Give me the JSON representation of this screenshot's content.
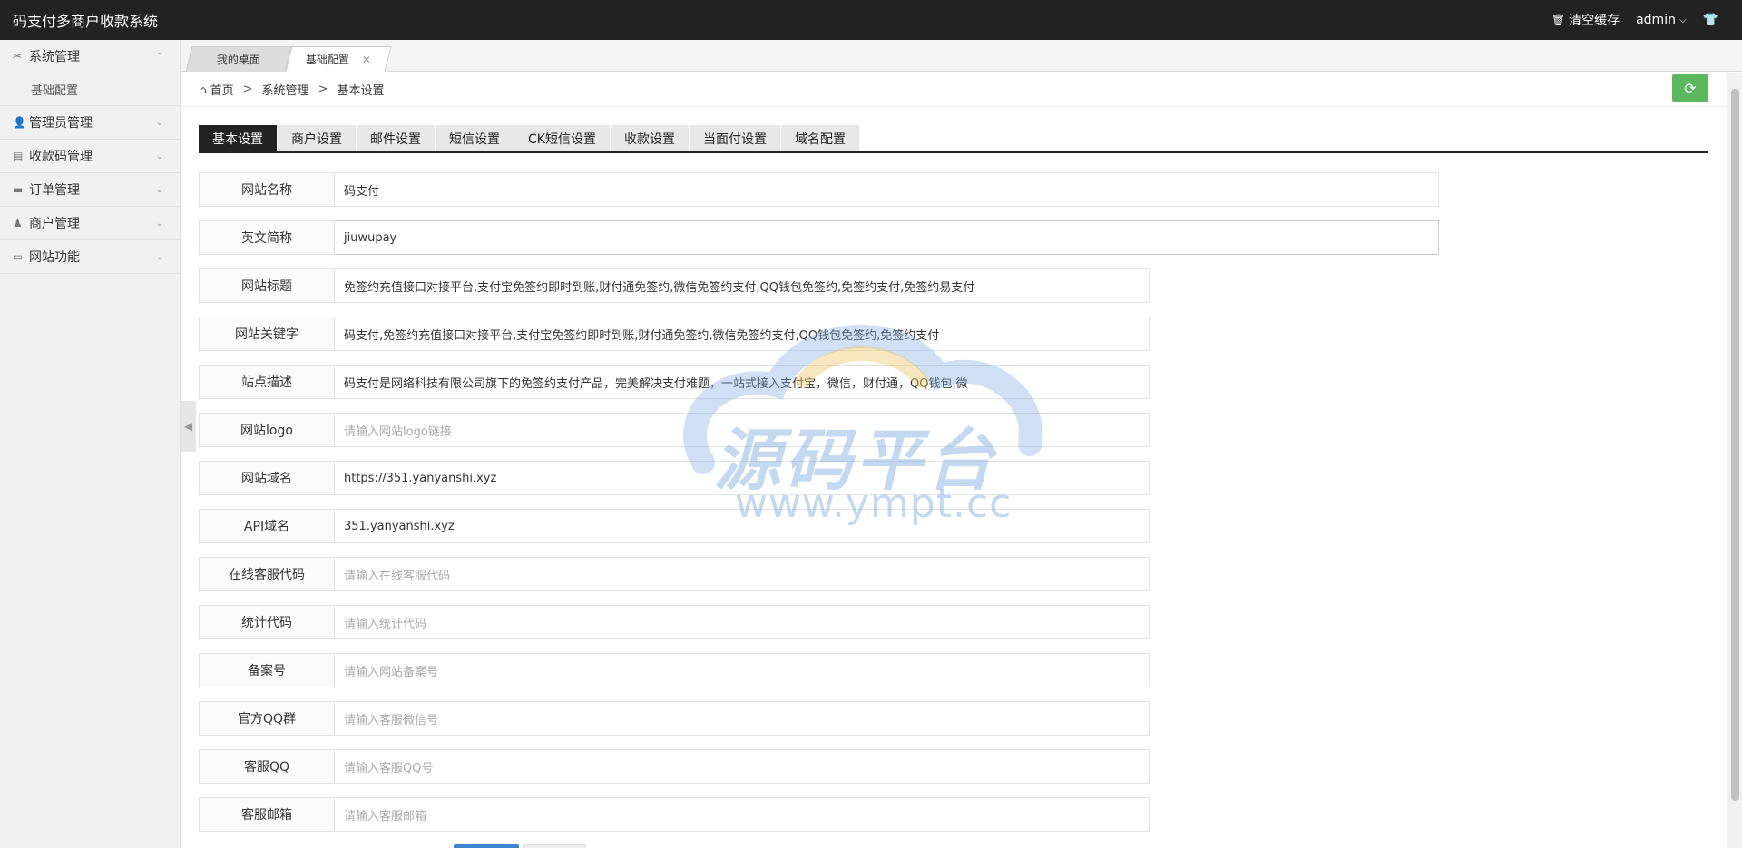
{
  "header": {
    "title": "码支付多商户收款系统",
    "clear_cache": "清空缓存",
    "user": "admin"
  },
  "sidebar": {
    "items": [
      {
        "label": "系统管理",
        "icon": "wrench-icon",
        "expanded": true,
        "children": [
          "基础配置"
        ]
      },
      {
        "label": "管理员管理",
        "icon": "user-icon"
      },
      {
        "label": "收款码管理",
        "icon": "list-icon"
      },
      {
        "label": "订单管理",
        "icon": "card-icon"
      },
      {
        "label": "商户管理",
        "icon": "merchant-icon"
      },
      {
        "label": "网站功能",
        "icon": "window-icon"
      }
    ]
  },
  "page_tabs": [
    {
      "label": "我的桌面",
      "active": false
    },
    {
      "label": "基础配置",
      "active": true
    }
  ],
  "breadcrumb": [
    "首页",
    "系统管理",
    "基本设置"
  ],
  "content_tabs": [
    "基本设置",
    "商户设置",
    "邮件设置",
    "短信设置",
    "CK短信设置",
    "收款设置",
    "当面付设置",
    "域名配置"
  ],
  "form": [
    {
      "label": "网站名称",
      "value": "码支付",
      "placeholder": ""
    },
    {
      "label": "英文简称",
      "value": "jiuwupay",
      "placeholder": ""
    },
    {
      "label": "网站标题",
      "value": "免签约充值接口对接平台,支付宝免签约即时到账,财付通免签约,微信免签约支付,QQ钱包免签约,免签约支付,免签约易支付",
      "placeholder": ""
    },
    {
      "label": "网站关键字",
      "value": "码支付,免签约充值接口对接平台,支付宝免签约即时到账,财付通免签约,微信免签约支付,QQ钱包免签约,免签约支付",
      "placeholder": ""
    },
    {
      "label": "站点描述",
      "value": "码支付是网络科技有限公司旗下的免签约支付产品，完美解决支付难题，一站式接入支付宝，微信，财付通，QQ钱包,微",
      "placeholder": ""
    },
    {
      "label": "网站logo",
      "value": "",
      "placeholder": "请输入网站logo链接"
    },
    {
      "label": "网站域名",
      "value": "https://351.yanyanshi.xyz",
      "placeholder": ""
    },
    {
      "label": "API域名",
      "value": "351.yanyanshi.xyz",
      "placeholder": ""
    },
    {
      "label": "在线客服代码",
      "value": "",
      "placeholder": "请输入在线客服代码"
    },
    {
      "label": "统计代码",
      "value": "",
      "placeholder": "请输入统计代码"
    },
    {
      "label": "备案号",
      "value": "",
      "placeholder": "请输入网站备案号"
    },
    {
      "label": "官方QQ群",
      "value": "",
      "placeholder": "请输入客服微信号"
    },
    {
      "label": "客服QQ",
      "value": "",
      "placeholder": "请输入客服QQ号"
    },
    {
      "label": "客服邮箱",
      "value": "",
      "placeholder": "请输入客服邮箱"
    }
  ],
  "watermark": {
    "text": "源码平台",
    "url": "www.ympt.cc"
  },
  "colors": {
    "header_bg": "#222222",
    "active_tab_bg": "#222222",
    "refresh_button": "#5cb85c"
  }
}
